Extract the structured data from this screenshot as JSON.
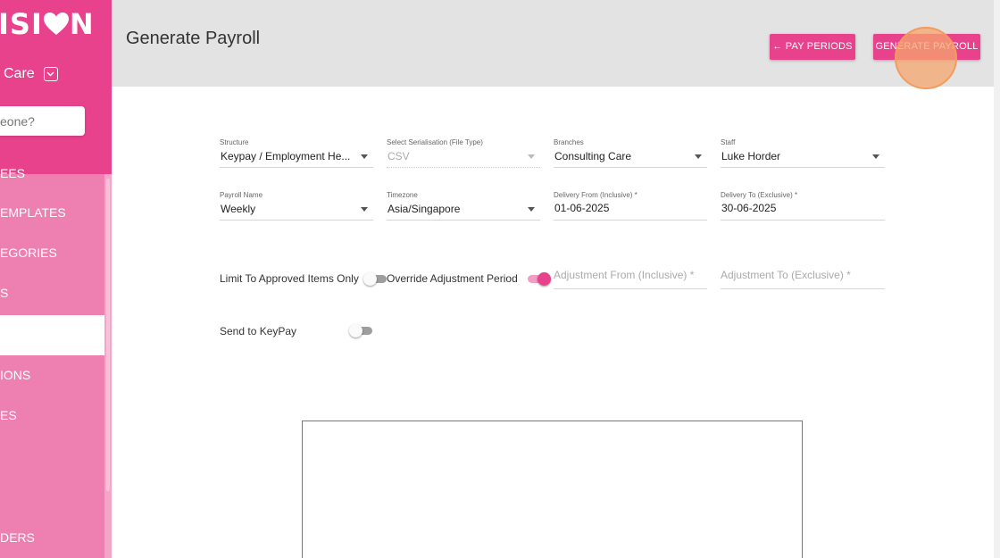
{
  "sidebar": {
    "logo_text": "ISI",
    "logo_text_after": "N",
    "org_name": "Care",
    "search_placeholder": "eone?",
    "items": [
      {
        "label": "EES"
      },
      {
        "label": "EMPLATES"
      },
      {
        "label": "EGORIES"
      },
      {
        "label": "S"
      },
      {
        "label": ""
      },
      {
        "label": "IONS"
      },
      {
        "label": "ES"
      },
      {
        "label": "DERS"
      }
    ]
  },
  "header": {
    "title": "Generate Payroll",
    "pay_periods_label": "← PAY PERIODS",
    "generate_label": "GENERATE PAYROLL"
  },
  "form": {
    "structure": {
      "label": "Structure",
      "value": "Keypay / Employment He..."
    },
    "serialisation": {
      "label": "Select Serialisation (File Type)",
      "value": "CSV"
    },
    "branches": {
      "label": "Branches",
      "value": "Consulting Care"
    },
    "staff": {
      "label": "Staff",
      "value": "Luke Horder"
    },
    "payroll_name": {
      "label": "Payroll Name",
      "value": "Weekly"
    },
    "timezone": {
      "label": "Timezone",
      "value": "Asia/Singapore"
    },
    "delivery_from": {
      "label": "Delivery From (Inclusive) *",
      "value": "01-06-2025"
    },
    "delivery_to": {
      "label": "Delivery To (Exclusive) *",
      "value": "30-06-2025"
    },
    "limit_approved": {
      "label": "Limit To Approved Items Only",
      "on": false
    },
    "override_adjustment": {
      "label": "Override Adjustment Period",
      "on": true
    },
    "adjustment_from": {
      "placeholder": "Adjustment From (Inclusive) *"
    },
    "adjustment_to": {
      "placeholder": "Adjustment To (Exclusive) *"
    },
    "send_keypay": {
      "label": "Send to KeyPay",
      "on": false
    }
  },
  "colors": {
    "brand": "#e8428c",
    "sidebar": "#ee7fb1",
    "header_bg": "#e3e3e3"
  },
  "icons": {
    "logo_heart": "heart-icon",
    "org_dropdown": "chevron-down-icon",
    "select_arrow": "caret-down-icon"
  }
}
